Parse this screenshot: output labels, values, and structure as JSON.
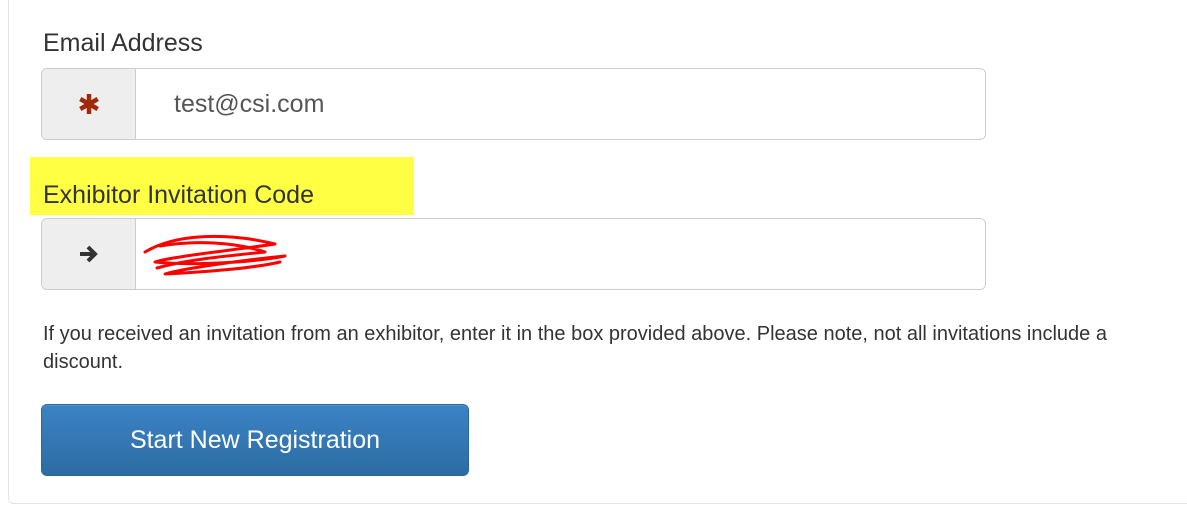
{
  "form": {
    "email": {
      "label": "Email Address",
      "value": "test@csi.com",
      "addon_icon": "asterisk-icon",
      "addon_color": "#a0280b"
    },
    "invitation": {
      "label": "Exhibitor Invitation Code",
      "value": "",
      "addon_icon": "arrow-right-icon",
      "highlight_color": "#ffff44",
      "redaction_color": "#ff0000"
    },
    "help_text": "If you received an invitation from an exhibitor, enter it in the box provided above. Please note, not all invitations include a discount.",
    "submit_label": "Start New Registration",
    "button_color": "#3479b7"
  }
}
